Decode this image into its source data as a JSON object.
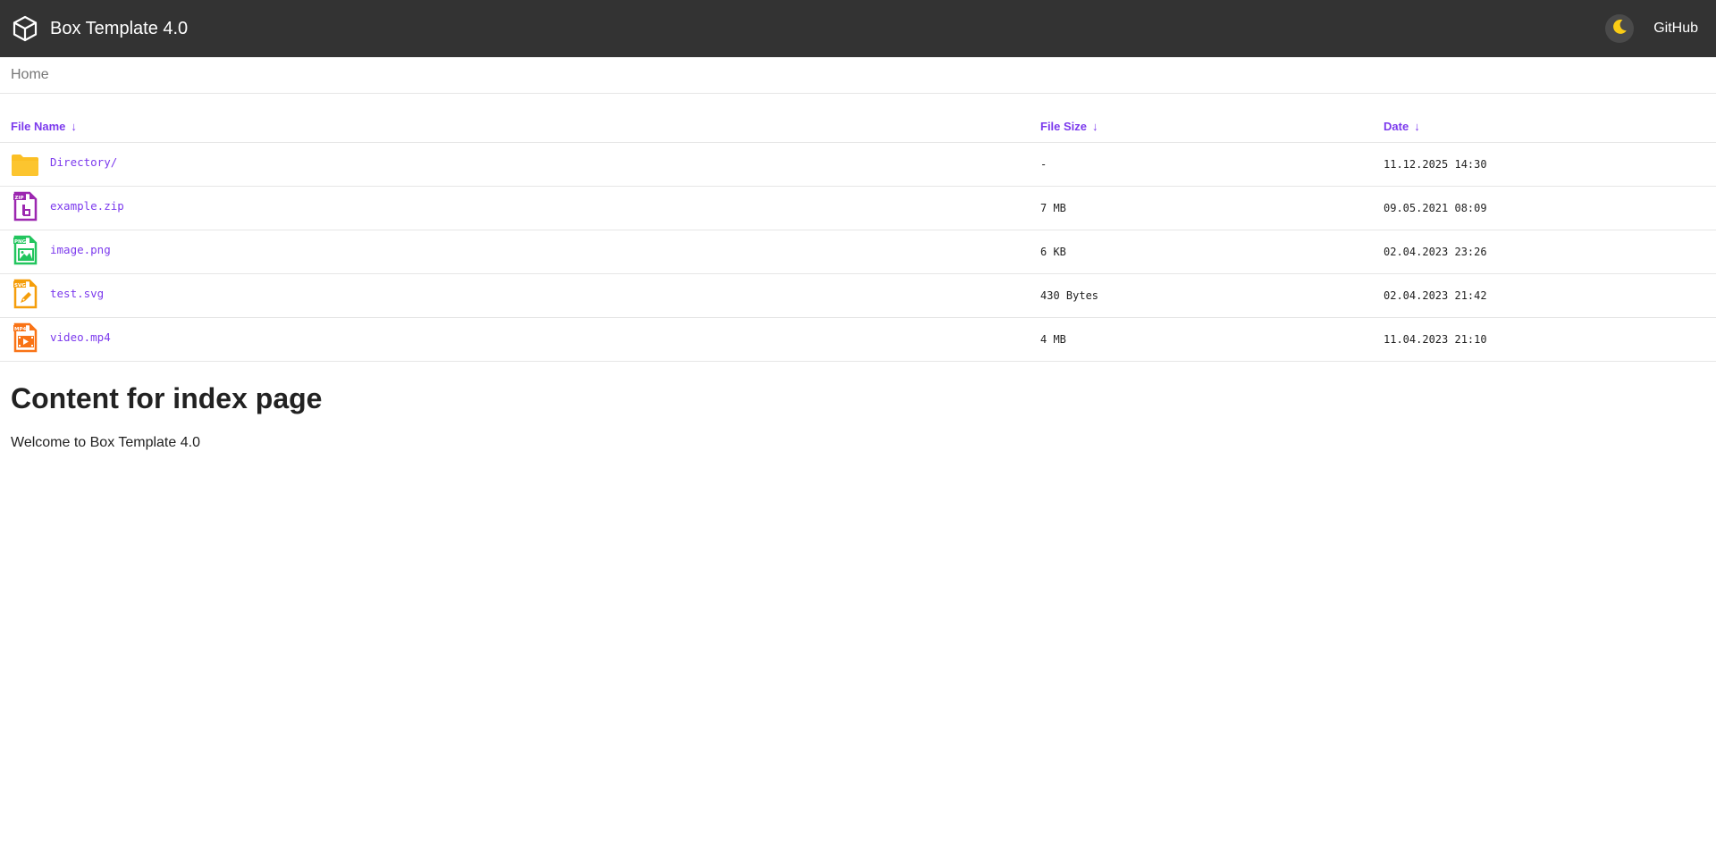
{
  "header": {
    "title": "Box Template 4.0",
    "logo_icon": "cube-icon",
    "theme_icon": "moon-icon",
    "github_label": "GitHub"
  },
  "breadcrumb": {
    "home": "Home"
  },
  "table": {
    "columns": [
      {
        "label": "File Name",
        "sort": "↓"
      },
      {
        "label": "File Size",
        "sort": "↓"
      },
      {
        "label": "Date",
        "sort": "↓"
      }
    ],
    "rows": [
      {
        "icon": "folder-icon",
        "name": "Directory/",
        "size": "-",
        "date": "11.12.2025 14:30"
      },
      {
        "icon": "zip-file-icon",
        "name": "example.zip",
        "size": "7 MB",
        "date": "09.05.2021 08:09"
      },
      {
        "icon": "png-file-icon",
        "name": "image.png",
        "size": "6 KB",
        "date": "02.04.2023 23:26"
      },
      {
        "icon": "svg-file-icon",
        "name": "test.svg",
        "size": "430 Bytes",
        "date": "02.04.2023 21:42"
      },
      {
        "icon": "mp4-file-icon",
        "name": "video.mp4",
        "size": "4 MB",
        "date": "11.04.2023 21:10"
      }
    ]
  },
  "icon_badges": {
    "zip": "ZIP",
    "png": "PNG",
    "svg": "SVG",
    "mp4": "MP4"
  },
  "content": {
    "title": "Content for index page",
    "text": "Welcome to Box Template 4.0"
  },
  "colors": {
    "header_bg": "#333333",
    "accent": "#7c3aed",
    "folder": "#fbbf24",
    "zip": "#9c27b0",
    "png": "#22c55e",
    "svg": "#f59e0b",
    "mp4": "#f97316",
    "moon": "#facc15"
  }
}
